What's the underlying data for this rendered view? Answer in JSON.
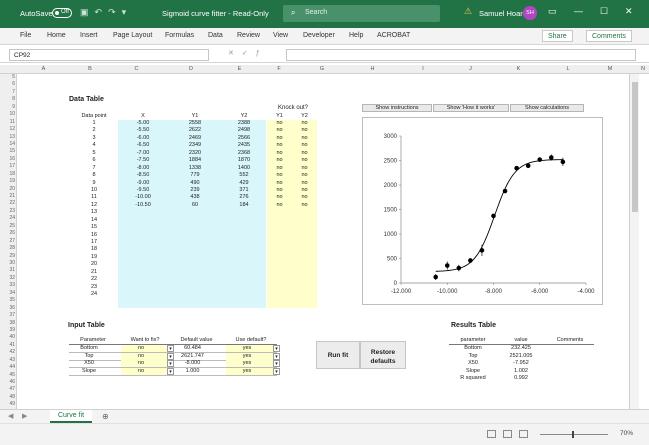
{
  "titlebar": {
    "autosave": "AutoSave",
    "toggle": "Off",
    "title": "Sigmoid curve fitter  -  Read-Only",
    "search_placeholder": "Search",
    "user": "Samuel Hoare",
    "initials": "SH"
  },
  "menu": [
    "File",
    "Home",
    "Insert",
    "Page Layout",
    "Formulas",
    "Data",
    "Review",
    "View",
    "Developer",
    "Help",
    "ACROBAT"
  ],
  "share": "Share",
  "comments": "Comments",
  "namebox": "CP92",
  "columns": [
    "A",
    "B",
    "C",
    "D",
    "E",
    "F",
    "G",
    "H",
    "I",
    "J",
    "K",
    "L",
    "M",
    "N"
  ],
  "rows": [
    "5",
    "6",
    "7",
    "8",
    "9",
    "10",
    "11",
    "12",
    "13",
    "14",
    "15",
    "16",
    "17",
    "18",
    "19",
    "20",
    "21",
    "22",
    "23",
    "24",
    "25",
    "26",
    "27",
    "28",
    "29",
    "30",
    "31",
    "32",
    "33",
    "34",
    "35",
    "36",
    "37",
    "38",
    "39",
    "40",
    "41",
    "42",
    "43",
    "44",
    "45",
    "46",
    "47",
    "48",
    "49"
  ],
  "data_table": {
    "title": "Data Table",
    "knock_out": "Knock out?",
    "headers": [
      "Data point",
      "X",
      "Y1",
      "Y2",
      "Y1",
      "Y2"
    ],
    "rows": [
      [
        "1",
        "-5.00",
        "2558",
        "2388",
        "no",
        "no"
      ],
      [
        "2",
        "-5.50",
        "2622",
        "2498",
        "no",
        "no"
      ],
      [
        "3",
        "-6.00",
        "2469",
        "2566",
        "no",
        "no"
      ],
      [
        "4",
        "-6.50",
        "2349",
        "2435",
        "no",
        "no"
      ],
      [
        "5",
        "-7.00",
        "2320",
        "2368",
        "no",
        "no"
      ],
      [
        "6",
        "-7.50",
        "1884",
        "1870",
        "no",
        "no"
      ],
      [
        "7",
        "-8.00",
        "1338",
        "1400",
        "no",
        "no"
      ],
      [
        "8",
        "-8.50",
        "779",
        "552",
        "no",
        "no"
      ],
      [
        "9",
        "-9.00",
        "490",
        "429",
        "no",
        "no"
      ],
      [
        "10",
        "-9.50",
        "239",
        "371",
        "no",
        "no"
      ],
      [
        "11",
        "-10.00",
        "438",
        "276",
        "no",
        "no"
      ],
      [
        "12",
        "-10.50",
        "60",
        "184",
        "no",
        "no"
      ],
      [
        "13",
        "",
        "",
        "",
        "",
        ""
      ],
      [
        "14",
        "",
        "",
        "",
        "",
        ""
      ],
      [
        "15",
        "",
        "",
        "",
        "",
        ""
      ],
      [
        "16",
        "",
        "",
        "",
        "",
        ""
      ],
      [
        "17",
        "",
        "",
        "",
        "",
        ""
      ],
      [
        "18",
        "",
        "",
        "",
        "",
        ""
      ],
      [
        "19",
        "",
        "",
        "",
        "",
        ""
      ],
      [
        "20",
        "",
        "",
        "",
        "",
        ""
      ],
      [
        "21",
        "",
        "",
        "",
        "",
        ""
      ],
      [
        "22",
        "",
        "",
        "",
        "",
        ""
      ],
      [
        "23",
        "",
        "",
        "",
        "",
        ""
      ],
      [
        "24",
        "",
        "",
        "",
        "",
        ""
      ]
    ]
  },
  "buttons": {
    "instructions": "Show instructions",
    "how": "Show 'How it works'",
    "calc": "Show calculations",
    "run": "Run fit",
    "restore_1": "Restore",
    "restore_2": "defaults"
  },
  "input_table": {
    "title": "Input Table",
    "headers": [
      "Parameter",
      "Want to fix?",
      "Default value",
      "Use default?"
    ],
    "rows": [
      [
        "Bottom",
        "no",
        "60.484",
        "yes"
      ],
      [
        "Top",
        "no",
        "2621.747",
        "yes"
      ],
      [
        "X50",
        "no",
        "-8.000",
        "yes"
      ],
      [
        "Slope",
        "no",
        "1.000",
        "yes"
      ]
    ]
  },
  "results_table": {
    "title": "Results Table",
    "headers": [
      "parameter",
      "value",
      "Comments"
    ],
    "rows": [
      [
        "Bottom",
        "232.425"
      ],
      [
        "Top",
        "2521.005"
      ],
      [
        "X50",
        "-7.952"
      ],
      [
        "Slope",
        "1.002"
      ],
      [
        "R squared",
        "0.992"
      ]
    ]
  },
  "chart_data": {
    "type": "scatter",
    "xlim": [
      -12,
      -4
    ],
    "ylim": [
      0,
      3000
    ],
    "x_ticks": [
      "-12.000",
      "-10.000",
      "-8.000",
      "-6.000",
      "-4.000"
    ],
    "y_ticks": [
      "0",
      "500",
      "1000",
      "1500",
      "2000",
      "2500",
      "3000"
    ],
    "points": [
      [
        -5.0,
        2473,
        85
      ],
      [
        -5.5,
        2560,
        62
      ],
      [
        -6.0,
        2518,
        49
      ],
      [
        -6.5,
        2392,
        43
      ],
      [
        -7.0,
        2344,
        24
      ],
      [
        -7.5,
        1877,
        7
      ],
      [
        -8.0,
        1369,
        31
      ],
      [
        -8.5,
        666,
        114
      ],
      [
        -9.0,
        460,
        31
      ],
      [
        -9.5,
        305,
        66
      ],
      [
        -10.0,
        357,
        81
      ],
      [
        -10.5,
        122,
        62
      ]
    ],
    "fit": {
      "bottom": 232.425,
      "top": 2521.005,
      "x50": -7.952,
      "slope": 1.002,
      "xrange": [
        -10.5,
        -5.0
      ]
    },
    "grid": false
  },
  "sheet_tab": "Curve fit",
  "zoom": "70%"
}
